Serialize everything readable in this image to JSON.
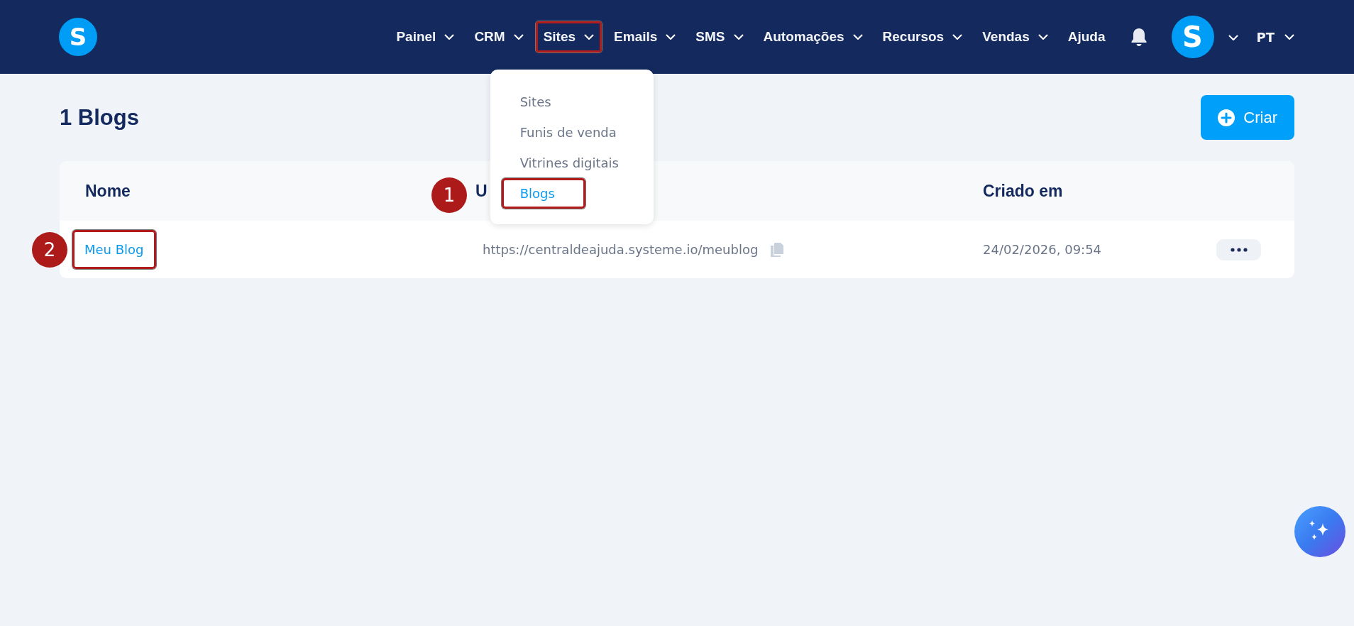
{
  "navbar": {
    "logo": "S",
    "items": [
      {
        "label": "Painel",
        "kind": "menu",
        "highlighted": false
      },
      {
        "label": "CRM",
        "kind": "menu",
        "highlighted": false
      },
      {
        "label": "Sites",
        "kind": "menu",
        "highlighted": true,
        "menu_items": [
          {
            "label": "Sites",
            "selected": false,
            "highlighted": false
          },
          {
            "label": "Funis de venda",
            "selected": false,
            "highlighted": false
          },
          {
            "label": "Vitrines digitais",
            "selected": false,
            "highlighted": false
          },
          {
            "label": "Blogs",
            "selected": true,
            "highlighted": true
          }
        ]
      },
      {
        "label": "Emails",
        "kind": "menu",
        "highlighted": false
      },
      {
        "label": "SMS",
        "kind": "menu",
        "highlighted": false
      },
      {
        "label": "Automações",
        "kind": "menu",
        "highlighted": false
      },
      {
        "label": "Recursos",
        "kind": "menu",
        "highlighted": false
      },
      {
        "label": "Vendas",
        "kind": "menu",
        "highlighted": false
      },
      {
        "label": "Ajuda",
        "kind": "link",
        "highlighted": false
      }
    ],
    "avatar": "S",
    "language": "PT"
  },
  "page": {
    "title": "1 Blogs",
    "create_button": "Criar"
  },
  "table": {
    "columns": [
      "Nome",
      "U",
      "Criado em"
    ],
    "rows": [
      {
        "name": "Meu Blog",
        "name_highlighted": true,
        "url": "https://centraldeajuda.systeme.io/meublog",
        "created": "24/02/2026, 09:54"
      }
    ]
  },
  "annotations": [
    {
      "number": "1"
    },
    {
      "number": "2"
    }
  ]
}
